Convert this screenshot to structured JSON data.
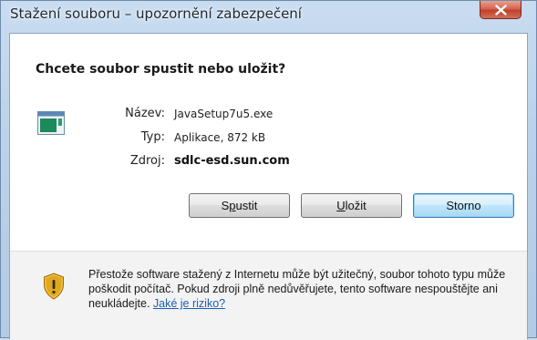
{
  "window": {
    "title": "Stažení souboru – upozornění zabezpečení",
    "close_icon": "close-icon"
  },
  "dialog": {
    "question": "Chcete soubor spustit nebo uložit?",
    "file_icon": "application-file-icon",
    "properties": [
      {
        "label": "Název:",
        "value": "JavaSetup7u5.exe",
        "bold": false
      },
      {
        "label": "Typ:",
        "value": "Aplikace, 872 kB",
        "bold": false
      },
      {
        "label": "Zdroj:",
        "value": "sdlc-esd.sun.com",
        "bold": true
      }
    ],
    "buttons": {
      "run_label": "Spustit",
      "run_accesskey": "p",
      "save_label": "Uložit",
      "save_accesskey": "U",
      "cancel_label": "Storno"
    }
  },
  "warning": {
    "icon": "security-shield-warning-icon",
    "text": "Přestože software stažený z Internetu může být užitečný, soubor tohoto typu může poškodit počítač. Pokud zdroji plně nedůvěřujete, tento software nespouštějte ani neukládejte.",
    "link_label": "Jaké je riziko?"
  },
  "colors": {
    "link": "#1a5fb4",
    "default_button_border": "#3c7fb1",
    "shield_gold": "#e0a820"
  }
}
